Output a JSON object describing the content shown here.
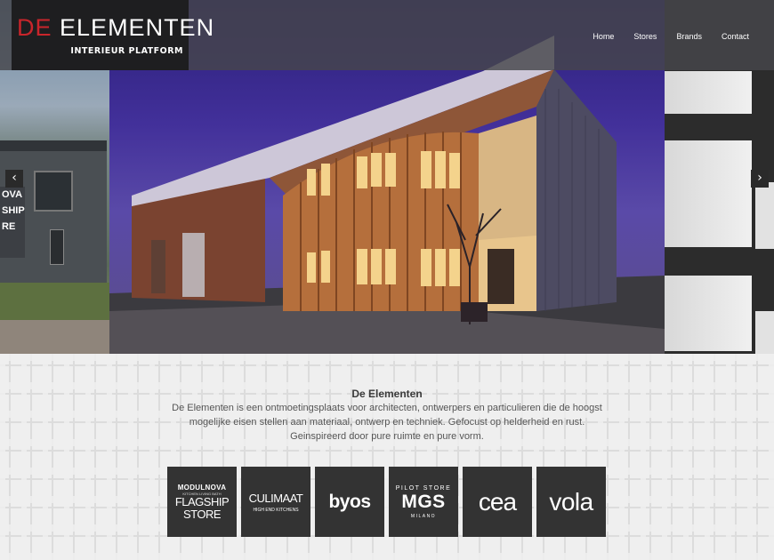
{
  "header": {
    "logo_main_prefix": "DE",
    "logo_main_rest": "ELEMENTEN",
    "logo_sub": "INTERIEUR PLATFORM",
    "nav": [
      {
        "label": "Home"
      },
      {
        "label": "Stores"
      },
      {
        "label": "Brands"
      },
      {
        "label": "Contact"
      }
    ]
  },
  "slider": {
    "prev_icon": "chevron-left-icon",
    "next_icon": "chevron-right-icon",
    "prev_glyph": "‹",
    "next_glyph": "›",
    "left_sign": "OVA\nSHIP\nRE"
  },
  "intro": {
    "title": "De Elementen",
    "description": "De Elementen is een ontmoetingsplaats voor architecten, ontwerpers en particulieren die de hoogst mogelijke eisen stellen aan materiaal, ontwerp en techniek. Gefocust op helderheid en rust. Geinspireerd door pure ruimte en pure vorm."
  },
  "brands": [
    {
      "lines": [
        "MODULNOVA",
        "KITCHEN LIVING BATH",
        "FLAGSHIP",
        "STORE"
      ]
    },
    {
      "lines": [
        "CULIMAAT",
        "HIGH END KITCHENS"
      ]
    },
    {
      "lines": [
        "byos"
      ]
    },
    {
      "lines": [
        "PILOT STORE",
        "MGS",
        "MILANO"
      ]
    },
    {
      "lines": [
        "cea"
      ]
    },
    {
      "lines": [
        "vola"
      ]
    }
  ],
  "colors": {
    "accent_red": "#c9252b",
    "header_bg": "#46464a",
    "tile_bg": "#333333"
  }
}
